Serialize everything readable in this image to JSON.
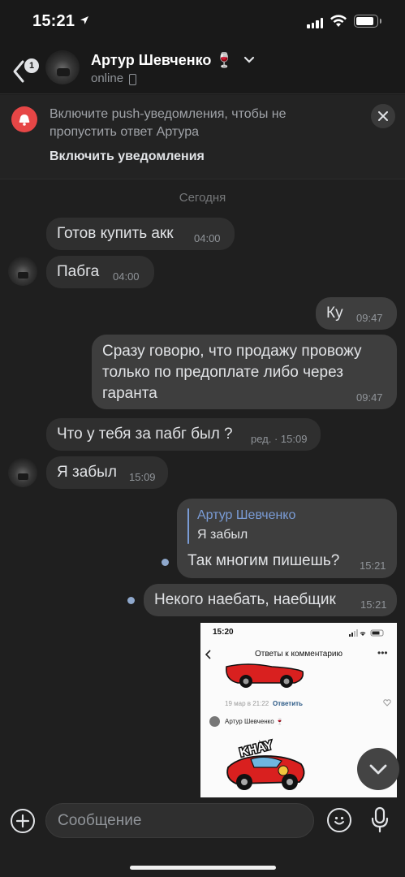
{
  "status_bar": {
    "time": "15:21"
  },
  "header": {
    "back_badge": "1",
    "name": "Артур Шевченко 🍷",
    "status": "online"
  },
  "push_banner": {
    "text": "Включите push-уведомления, чтобы не пропустить ответ Артура",
    "link": "Включить уведомления"
  },
  "date_separator": "Сегодня",
  "messages": [
    {
      "direction": "in",
      "text": "Готов купить акк",
      "time": "04:00"
    },
    {
      "direction": "in",
      "text": "Пабга",
      "time": "04:00"
    },
    {
      "direction": "out",
      "text": "Ку",
      "time": "09:47"
    },
    {
      "direction": "out",
      "lines": [
        "Сразу говорю, что продажу провожу",
        "только по предоплате либо через",
        "гаранта"
      ],
      "time": "09:47"
    },
    {
      "direction": "in",
      "text": "Что у тебя за пабг был ?",
      "time": "ред. · 15:09"
    },
    {
      "direction": "in",
      "text": "Я забыл",
      "time": "15:09"
    },
    {
      "direction": "out",
      "reply_author": "Артур Шевченко",
      "reply_text": "Я забыл",
      "text": "Так многим пишешь?",
      "time": "15:21",
      "unread": true
    },
    {
      "direction": "out",
      "text": "Некого наебать, наебщик",
      "time": "15:21",
      "unread": true
    }
  ],
  "embedded_screenshot": {
    "time": "15:20",
    "title": "Ответы к комментарию",
    "comment_date": "19 мар в 21:22",
    "reply_label": "Ответить",
    "user": "Артур Шевченко 🍷",
    "sticker_text": "KHAY"
  },
  "composer": {
    "placeholder": "Сообщение"
  },
  "colors": {
    "background": "#1f1f1f",
    "bubble_in": "#2f2f2f",
    "bubble_out": "#3e3e3e",
    "accent_blue": "#7a9cd6",
    "push_red": "#e64646"
  }
}
